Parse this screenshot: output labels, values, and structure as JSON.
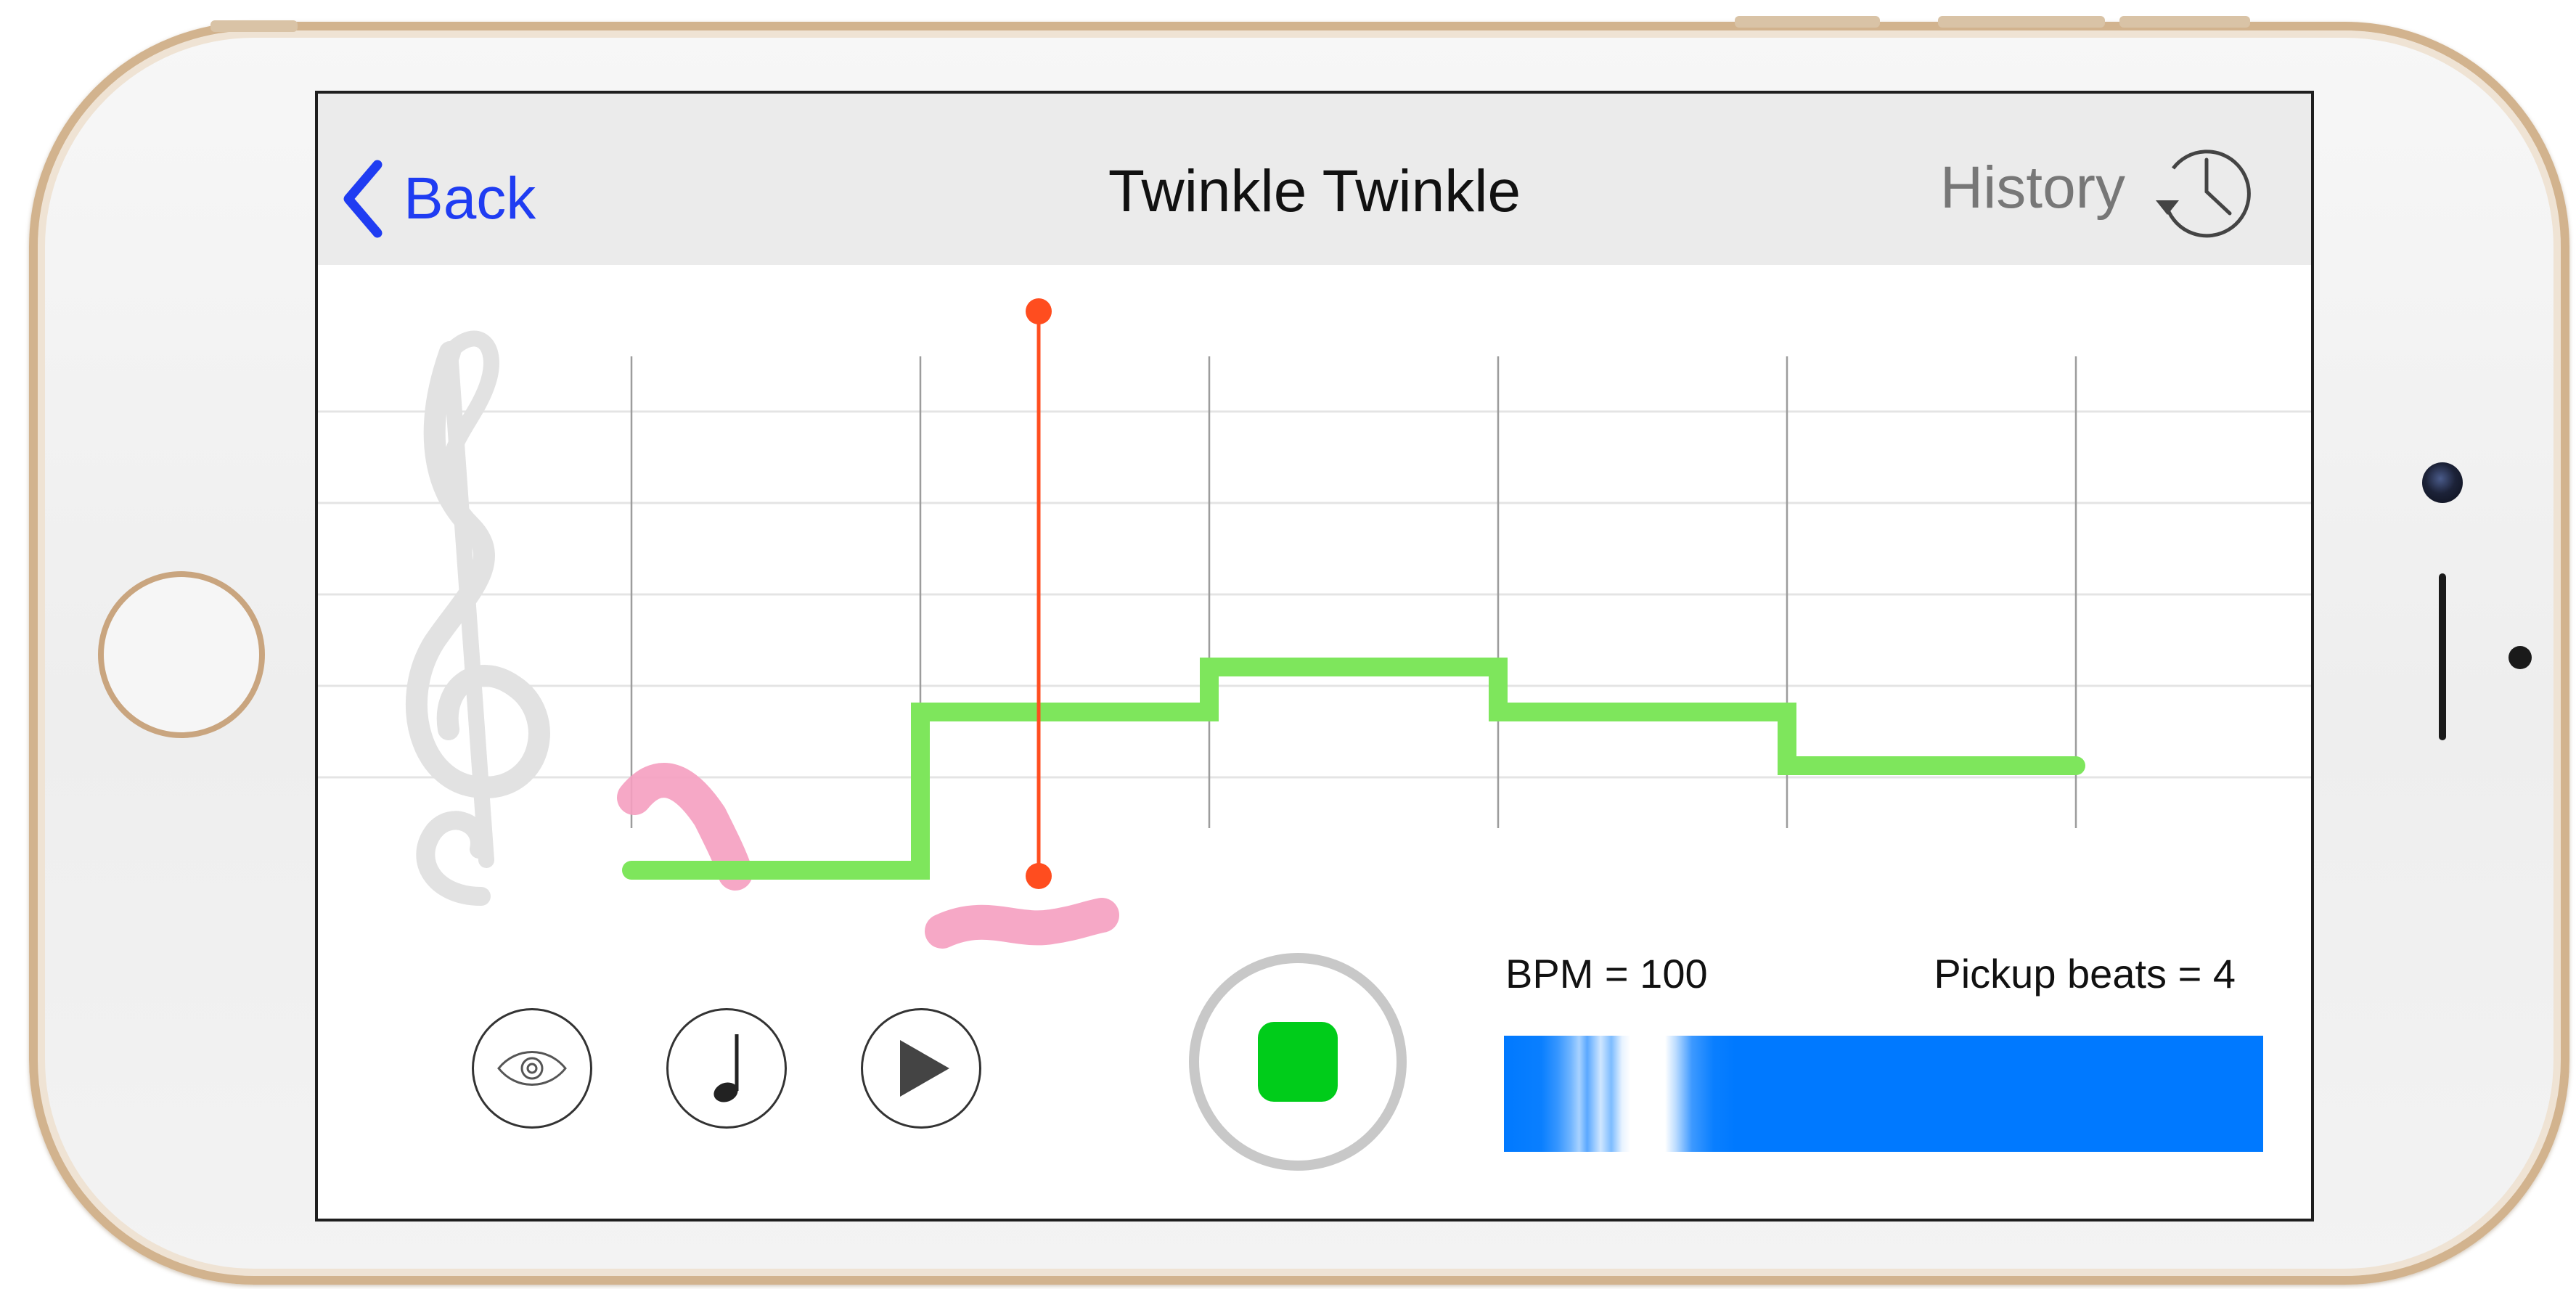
{
  "navbar": {
    "back_label": "Back",
    "title": "Twinkle Twinkle",
    "history_label": "History"
  },
  "staff": {
    "clef_icon": "treble-clef-icon",
    "measure_count": 5
  },
  "controls": {
    "view_icon": "eye-icon",
    "note_icon": "quarter-note-icon",
    "play_icon": "play-icon",
    "record_icon": "stop-icon"
  },
  "settings": {
    "bpm_label": "BPM = 100",
    "pickup_label": "Pickup beats = 4"
  },
  "colors": {
    "target_melody": "#7ee65c",
    "sung_pitch": "#f59ec0",
    "playhead": "#ff4d1f",
    "accent": "#1f3cf2",
    "stop": "#00cc1a",
    "meter": "#0079ff"
  }
}
